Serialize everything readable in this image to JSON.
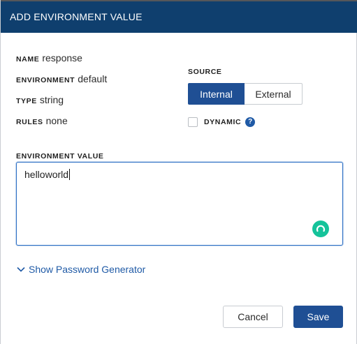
{
  "dialog": {
    "title": "ADD ENVIRONMENT VALUE"
  },
  "meta": {
    "name_label": "NAME",
    "name_value": "response",
    "environment_label": "ENVIRONMENT",
    "environment_value": "default",
    "type_label": "TYPE",
    "type_value": "string",
    "rules_label": "RULES",
    "rules_value": "none"
  },
  "source": {
    "label": "SOURCE",
    "options": [
      "Internal",
      "External"
    ],
    "selected": "Internal"
  },
  "dynamic": {
    "label": "DYNAMIC",
    "checked": false,
    "help_glyph": "?"
  },
  "value_field": {
    "label": "ENVIRONMENT VALUE",
    "value": "helloworld"
  },
  "password_generator": {
    "label": "Show Password Generator"
  },
  "actions": {
    "cancel": "Cancel",
    "save": "Save"
  },
  "colors": {
    "header_bg": "#0f3f6e",
    "primary": "#1f4f94",
    "link": "#1f5aa6",
    "grammar_green": "#15c39a"
  },
  "icons": {
    "chevron": "chevron-down-icon",
    "help": "help-icon",
    "grammar": "grammar-assistant-icon"
  }
}
